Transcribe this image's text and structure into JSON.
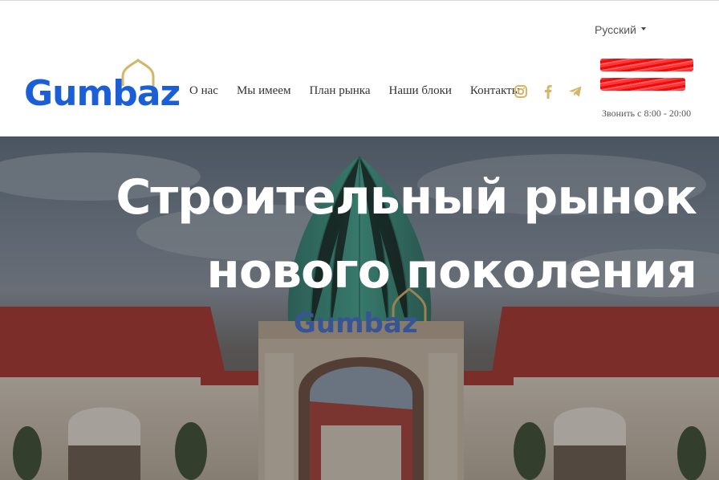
{
  "header": {
    "logo_text": "Gumbaz",
    "language": "Русский",
    "nav": [
      {
        "label": "О нас"
      },
      {
        "label": "Мы имеем"
      },
      {
        "label": "План рынка"
      },
      {
        "label": "Наши блоки"
      },
      {
        "label": "Контакты"
      }
    ],
    "socials": [
      "instagram-icon",
      "facebook-icon",
      "telegram-icon"
    ],
    "hours": "Звонить с 8:00 - 20:00"
  },
  "hero": {
    "title_line1": "Строительный рынок",
    "title_line2": "нового поколения",
    "sign_text": "Gumbaz"
  },
  "colors": {
    "brand_blue": "#1a5fd8",
    "brand_gold": "#d6b46a",
    "roof_red": "#a8322a"
  }
}
